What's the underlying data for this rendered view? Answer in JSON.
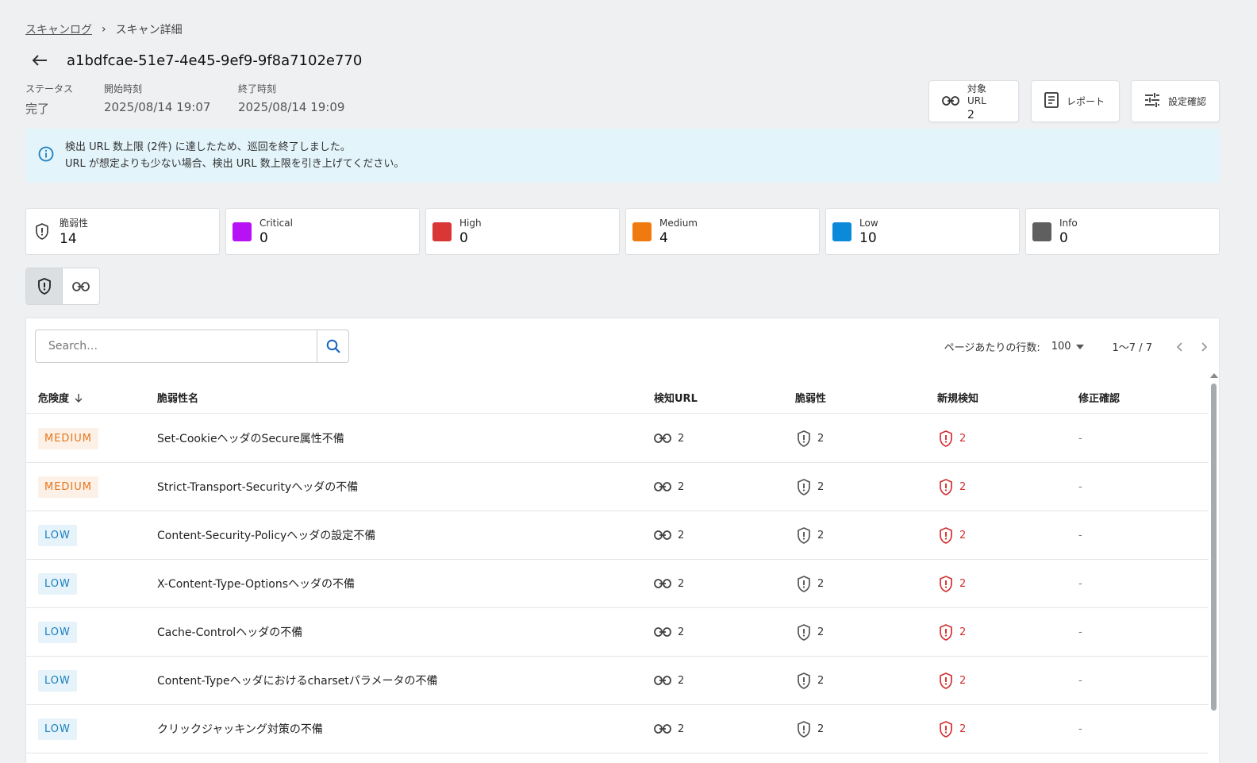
{
  "breadcrumb": {
    "parent": "スキャンログ",
    "current": "スキャン詳細"
  },
  "title": "a1bdfcae-51e7-4e45-9ef9-9f8a7102e770",
  "meta": [
    {
      "label": "ステータス",
      "value": "完了"
    },
    {
      "label": "開始時刻",
      "value": "2025/08/14 19:07"
    },
    {
      "label": "終了時刻",
      "value": "2025/08/14 19:09"
    }
  ],
  "header_buttons": {
    "target_url": {
      "label": "対象 URL",
      "count": "2"
    },
    "report": {
      "label": "レポート"
    },
    "settings": {
      "label": "設定確認"
    }
  },
  "alert": {
    "line1": "検出 URL 数上限 (2件) に達したため、巡回を終了しました。",
    "line2": "URL が想定よりも少ない場合、検出 URL 数上限を引き上げてください。"
  },
  "stats": [
    {
      "label": "脆弱性",
      "value": "14",
      "icon": "shield-icon"
    },
    {
      "label": "Critical",
      "value": "0",
      "color": "#b712f5"
    },
    {
      "label": "High",
      "value": "0",
      "color": "#d93636"
    },
    {
      "label": "Medium",
      "value": "4",
      "color": "#f07a10"
    },
    {
      "label": "Low",
      "value": "10",
      "color": "#0b8ad9"
    },
    {
      "label": "Info",
      "value": "0",
      "color": "#5f5f5f"
    }
  ],
  "search": {
    "placeholder": "Search…"
  },
  "pagination": {
    "rows_label": "ページあたりの行数:",
    "rows_value": "100",
    "range": "1〜7 / 7"
  },
  "table": {
    "columns": [
      "危険度",
      "脆弱性名",
      "検知URL",
      "脆弱性",
      "新規検知",
      "修正確認"
    ],
    "rows": [
      {
        "severity": "MEDIUM",
        "name": "Set-CookieヘッダのSecure属性不備",
        "urls": "2",
        "vulns": "2",
        "new": "2",
        "fixed": "-"
      },
      {
        "severity": "MEDIUM",
        "name": "Strict-Transport-Securityヘッダの不備",
        "urls": "2",
        "vulns": "2",
        "new": "2",
        "fixed": "-"
      },
      {
        "severity": "LOW",
        "name": "Content-Security-Policyヘッダの設定不備",
        "urls": "2",
        "vulns": "2",
        "new": "2",
        "fixed": "-"
      },
      {
        "severity": "LOW",
        "name": "X-Content-Type-Optionsヘッダの不備",
        "urls": "2",
        "vulns": "2",
        "new": "2",
        "fixed": "-"
      },
      {
        "severity": "LOW",
        "name": "Cache-Controlヘッダの不備",
        "urls": "2",
        "vulns": "2",
        "new": "2",
        "fixed": "-"
      },
      {
        "severity": "LOW",
        "name": "Content-Typeヘッダにおけるcharsetパラメータの不備",
        "urls": "2",
        "vulns": "2",
        "new": "2",
        "fixed": "-"
      },
      {
        "severity": "LOW",
        "name": "クリックジャッキング対策の不備",
        "urls": "2",
        "vulns": "2",
        "new": "2",
        "fixed": "-"
      }
    ]
  }
}
